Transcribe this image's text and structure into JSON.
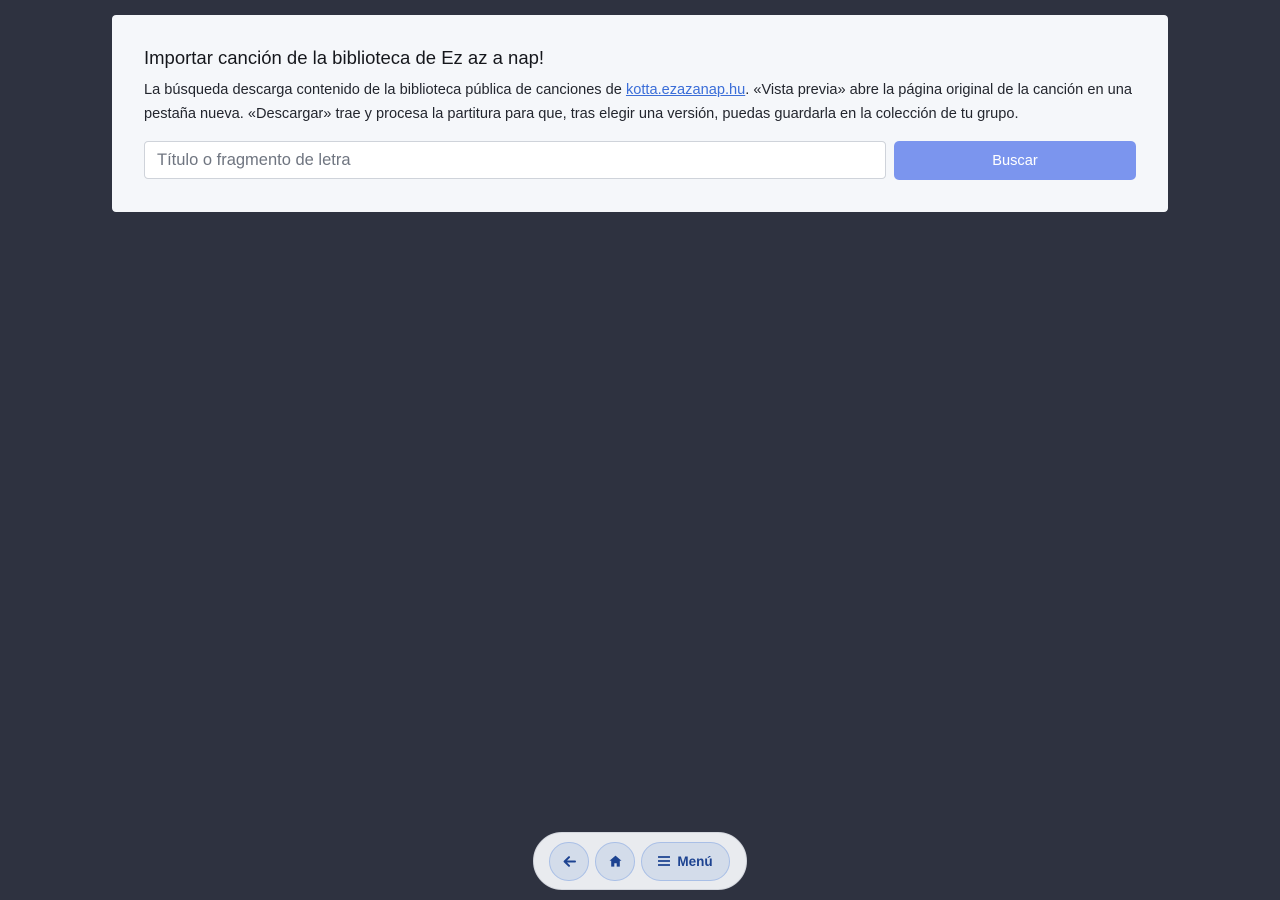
{
  "import_panel": {
    "title": "Importar canción de la biblioteca de Ez az a nap!",
    "description_before": "La búsqueda descarga contenido de la biblioteca pública de canciones de ",
    "link_text": "kotta.ezazanap.hu",
    "description_after": ". «Vista previa» abre la página original de la canción en una pestaña nueva. «Descargar» trae y procesa la partitura para que, tras elegir una versión, puedas guardarla en la colección de tu grupo.",
    "search": {
      "placeholder": "Título o fragmento de letra",
      "value": "",
      "button_label": "Buscar"
    }
  },
  "bottom_nav": {
    "back_icon": "arrow-left-icon",
    "home_icon": "home-icon",
    "menu_icon": "hamburger-icon",
    "menu_label": "Menú"
  },
  "colors": {
    "page_background": "#2e3240",
    "panel_background": "#f5f7fa",
    "link": "#3b6ed8",
    "search_button": "#7b95ee",
    "nav_accent": "#1d4391"
  }
}
